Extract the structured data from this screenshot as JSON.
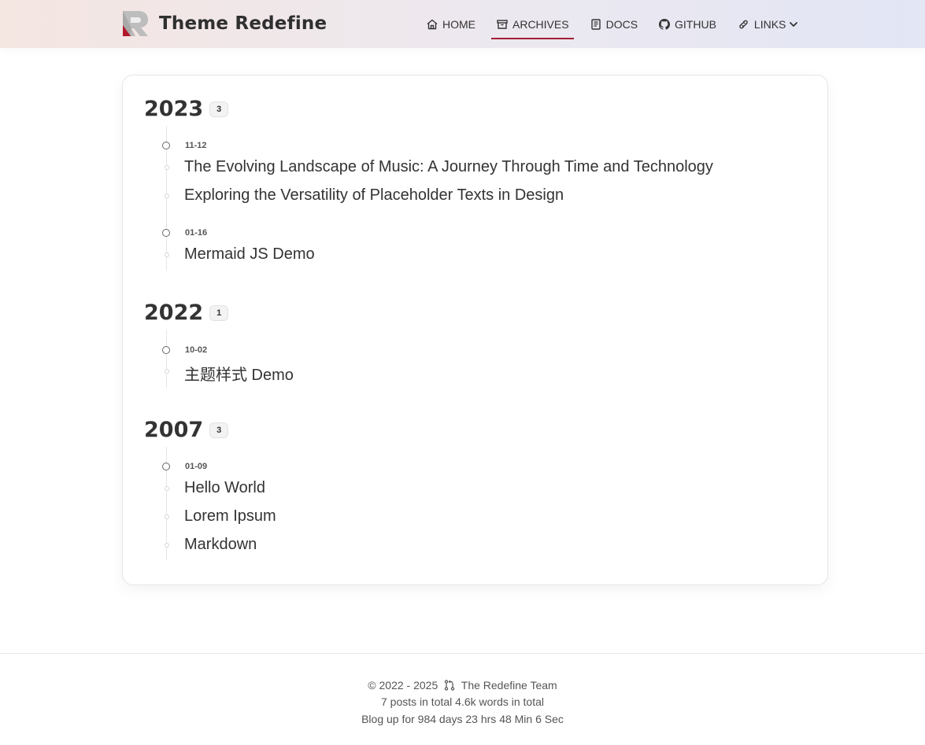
{
  "header": {
    "site_title": "Theme Redefine",
    "nav": [
      {
        "label": "HOME",
        "icon": "home-icon"
      },
      {
        "label": "ARCHIVES",
        "icon": "archive-icon",
        "active": true
      },
      {
        "label": "DOCS",
        "icon": "book-icon"
      },
      {
        "label": "GITHUB",
        "icon": "github-icon"
      },
      {
        "label": "LINKS",
        "icon": "link-icon",
        "dropdown": true
      }
    ],
    "accent_color": "#a31f34"
  },
  "archives": [
    {
      "year": "2023",
      "count": "3",
      "groups": [
        {
          "date": "11-12",
          "posts": [
            "The Evolving Landscape of Music: A Journey Through Time and Technology",
            "Exploring the Versatility of Placeholder Texts in Design"
          ]
        },
        {
          "date": "01-16",
          "posts": [
            "Mermaid JS Demo"
          ]
        }
      ]
    },
    {
      "year": "2022",
      "count": "1",
      "groups": [
        {
          "date": "10-02",
          "posts": [
            "主题样式 Demo"
          ]
        }
      ]
    },
    {
      "year": "2007",
      "count": "3",
      "groups": [
        {
          "date": "01-09",
          "posts": [
            "Hello World",
            "Lorem Ipsum",
            "Markdown"
          ]
        }
      ]
    }
  ],
  "footer": {
    "copyright": "© 2022 - 2025",
    "team": "The Redefine Team",
    "posts_total": "7 posts in total",
    "words_total": "4.6k words in total",
    "uptime": "Blog up for 984 days 23 hrs 48 Min 6 Sec"
  }
}
